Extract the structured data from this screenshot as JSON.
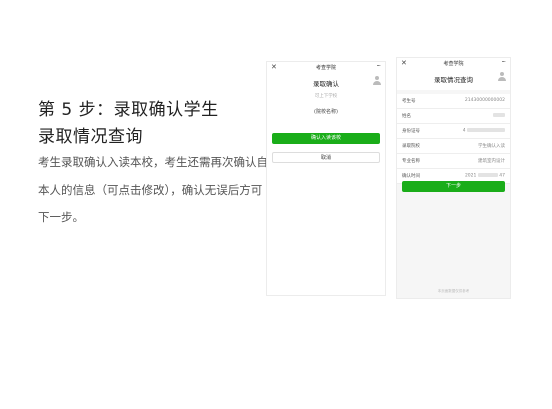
{
  "slide": {
    "title_line1": "第 5 步：录取确认学生",
    "title_line2": "录取情况查询",
    "desc_line1": "考生录取确认入读本校，考生还需再次确认自己",
    "desc_line2": "本人的信息（可点击修改），确认无误后方可",
    "desc_line3": "下一步。"
  },
  "phone1": {
    "close_glyph": "✕",
    "app_title": "考查学院",
    "more_glyph": "···",
    "page_title": "录取确认",
    "subtitle": "可上下学校",
    "school_name": "(院校名称)",
    "confirm_button": "确认入读该校",
    "cancel_button": "取消"
  },
  "phone2": {
    "close_glyph": "✕",
    "app_title": "考查学院",
    "more_glyph": "···",
    "page_title": "录取情况查询",
    "rows": [
      {
        "label": "考生号",
        "value": "21430000000002"
      },
      {
        "label": "姓名",
        "value": ""
      },
      {
        "label": "身份证号",
        "value": "4"
      },
      {
        "label": "录取院校",
        "value": "学生确认入读"
      },
      {
        "label": "专业名称",
        "value": "建筑室内设计"
      },
      {
        "label": "确认时间",
        "value": "2021",
        "value_tail": "47"
      }
    ],
    "next_button": "下一步",
    "footnote": "本页面数据仅供参考"
  },
  "colors": {
    "accent": "#1aad19"
  }
}
